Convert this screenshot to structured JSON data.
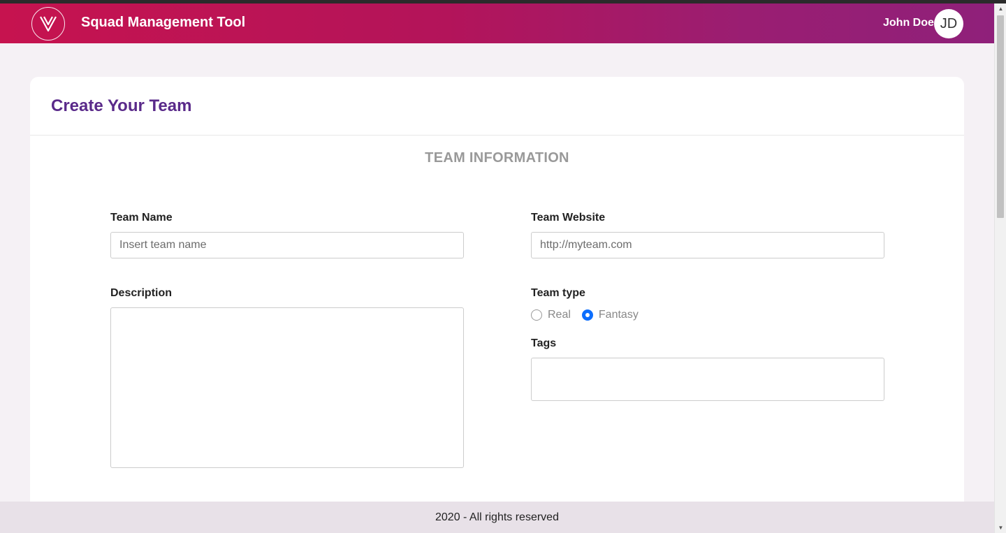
{
  "header": {
    "app_title": "Squad Management Tool",
    "user_name": "John Doe",
    "user_initials": "JD",
    "logo_icon": "v-logo-icon"
  },
  "card": {
    "title": "Create Your Team",
    "section_title": "TEAM INFORMATION"
  },
  "form": {
    "team_name": {
      "label": "Team Name",
      "placeholder": "Insert team name",
      "value": ""
    },
    "team_website": {
      "label": "Team Website",
      "placeholder": "http://myteam.com",
      "value": ""
    },
    "description": {
      "label": "Description",
      "value": ""
    },
    "team_type": {
      "label": "Team type",
      "options": [
        "Real",
        "Fantasy"
      ],
      "selected": "Fantasy"
    },
    "tags": {
      "label": "Tags",
      "value": ""
    }
  },
  "footer": {
    "text": "2020 - All rights reserved"
  },
  "colors": {
    "header_gradient_start": "#c6134f",
    "header_gradient_end": "#8f207a",
    "title_purple": "#5a2a8a",
    "radio_blue": "#0d6efd"
  }
}
